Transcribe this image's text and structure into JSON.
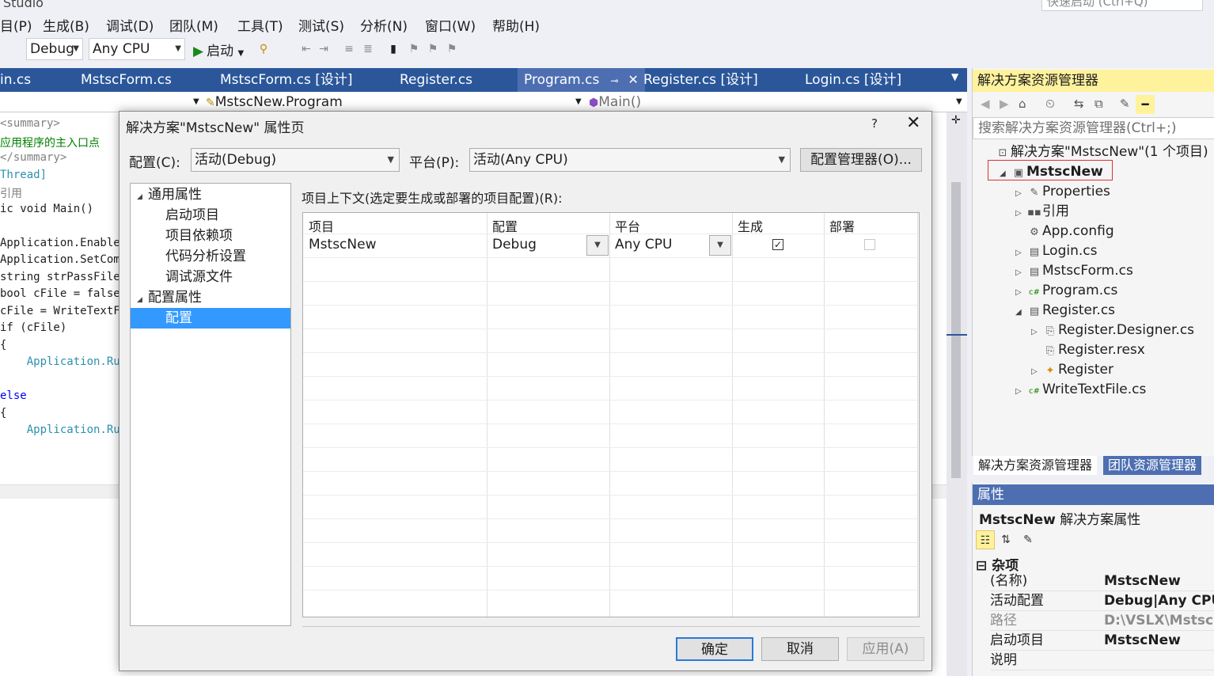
{
  "window": {
    "title_fragment": "Studio",
    "quick_launch": "快速启动 (Ctrl+Q)"
  },
  "menu": [
    "目(P)",
    "生成(B)",
    "调试(D)",
    "团队(M)",
    "工具(T)",
    "测试(S)",
    "分析(N)",
    "窗口(W)",
    "帮助(H)"
  ],
  "toolbar": {
    "config_combo": "Debug",
    "platform_combo": "Any CPU",
    "start_label": "启动"
  },
  "tabs": [
    {
      "label": "in.cs",
      "active": false
    },
    {
      "label": "MstscForm.cs",
      "active": false
    },
    {
      "label": "MstscForm.cs [设计]",
      "active": false
    },
    {
      "label": "Register.cs",
      "active": false
    },
    {
      "label": "Program.cs",
      "active": true
    },
    {
      "label": "Register.cs [设计]",
      "active": false
    },
    {
      "label": "Login.cs [设计]",
      "active": false
    }
  ],
  "navbar": {
    "class_combo": "MstscNew.Program",
    "member_combo": "Main()"
  },
  "code": [
    {
      "t": "<summary>",
      "c": "c-gray"
    },
    {
      "t": "应用程序的主入口点",
      "c": "c-green"
    },
    {
      "t": "</summary>",
      "c": "c-gray"
    },
    {
      "t": "Thread]",
      "c": "c-teal"
    },
    {
      "t": "引用",
      "c": "c-gray"
    },
    {
      "t": "ic void Main()",
      "c": "c-dark"
    },
    {
      "t": "",
      "c": "c-dark"
    },
    {
      "t": "Application.Enable",
      "c": "c-dark"
    },
    {
      "t": "Application.SetCom",
      "c": "c-dark"
    },
    {
      "t": "string strPassFile",
      "c": "c-dark"
    },
    {
      "t": "bool cFile = false",
      "c": "c-dark"
    },
    {
      "t": "cFile = WriteTextF",
      "c": "c-dark"
    },
    {
      "t": "if (cFile)",
      "c": "c-dark"
    },
    {
      "t": "{",
      "c": "c-dark"
    },
    {
      "t": "    Application.Ru",
      "c": "c-teal"
    },
    {
      "t": "",
      "c": "c-dark"
    },
    {
      "t": "else",
      "c": "c-blue"
    },
    {
      "t": "{",
      "c": "c-dark"
    },
    {
      "t": "    Application.Ru",
      "c": "c-teal"
    }
  ],
  "solution_explorer": {
    "title": "解决方案资源管理器",
    "search_placeholder": "搜索解决方案资源管理器(Ctrl+;)",
    "items": [
      {
        "label": "解决方案\"MstscNew\"(1 个项目)",
        "indent": 0,
        "exp": "",
        "icon": "solution-icon",
        "glyph": "⊡",
        "bold": false
      },
      {
        "label": "MstscNew",
        "indent": 1,
        "exp": "◢",
        "icon": "csharp-project-icon",
        "glyph": "▣",
        "bold": true
      },
      {
        "label": "Properties",
        "indent": 2,
        "exp": "▷",
        "icon": "wrench-icon",
        "glyph": "✎",
        "bold": false
      },
      {
        "label": "引用",
        "indent": 2,
        "exp": "▷",
        "icon": "references-icon",
        "glyph": "▪▪",
        "bold": false
      },
      {
        "label": "App.config",
        "indent": 2,
        "exp": "",
        "icon": "config-file-icon",
        "glyph": "⚙",
        "bold": false
      },
      {
        "label": "Login.cs",
        "indent": 2,
        "exp": "▷",
        "icon": "form-icon",
        "glyph": "▤",
        "bold": false
      },
      {
        "label": "MstscForm.cs",
        "indent": 2,
        "exp": "▷",
        "icon": "form-icon",
        "glyph": "▤",
        "bold": false
      },
      {
        "label": "Program.cs",
        "indent": 2,
        "exp": "▷",
        "icon": "csharp-file-icon",
        "glyph": "c#",
        "bold": false
      },
      {
        "label": "Register.cs",
        "indent": 2,
        "exp": "◢",
        "icon": "form-icon",
        "glyph": "▤",
        "bold": false
      },
      {
        "label": "Register.Designer.cs",
        "indent": 3,
        "exp": "▷",
        "icon": "designer-file-icon",
        "glyph": "⎘",
        "bold": false
      },
      {
        "label": "Register.resx",
        "indent": 3,
        "exp": "",
        "icon": "resx-file-icon",
        "glyph": "⎘",
        "bold": false
      },
      {
        "label": "Register",
        "indent": 3,
        "exp": "▷",
        "icon": "class-icon",
        "glyph": "✦",
        "bold": false
      },
      {
        "label": "WriteTextFile.cs",
        "indent": 2,
        "exp": "▷",
        "icon": "csharp-file-icon",
        "glyph": "c#",
        "bold": false
      }
    ],
    "tabs": [
      "解决方案资源管理器",
      "团队资源管理器"
    ]
  },
  "properties": {
    "title": "属性",
    "subject_name": "MstscNew",
    "subject_type": "解决方案属性",
    "category": "杂项",
    "rows": [
      {
        "key": "(名称)",
        "value": "MstscNew",
        "dim": false
      },
      {
        "key": "活动配置",
        "value": "Debug|Any CPU",
        "dim": false
      },
      {
        "key": "路径",
        "value": "D:\\VSLX\\MstscN",
        "dim": true
      },
      {
        "key": "启动项目",
        "value": "MstscNew",
        "dim": false
      },
      {
        "key": "说明",
        "value": "",
        "dim": false
      }
    ]
  },
  "dialog": {
    "title": "解决方案\"MstscNew\" 属性页",
    "help": "?",
    "config_label": "配置(C):",
    "config_value": "活动(Debug)",
    "platform_label": "平台(P):",
    "platform_value": "活动(Any CPU)",
    "config_manager_button": "配置管理器(O)...",
    "tree": [
      {
        "label": "通用属性",
        "level": 0,
        "exp": "◢",
        "selected": false
      },
      {
        "label": "启动项目",
        "level": 1,
        "exp": "",
        "selected": false
      },
      {
        "label": "项目依赖项",
        "level": 1,
        "exp": "",
        "selected": false
      },
      {
        "label": "代码分析设置",
        "level": 1,
        "exp": "",
        "selected": false
      },
      {
        "label": "调试源文件",
        "level": 1,
        "exp": "",
        "selected": false
      },
      {
        "label": "配置属性",
        "level": 0,
        "exp": "◢",
        "selected": false
      },
      {
        "label": "配置",
        "level": 1,
        "exp": "",
        "selected": true
      }
    ],
    "context_label": "项目上下文(选定要生成或部署的项目配置)(R):",
    "grid": {
      "headers": [
        "项目",
        "配置",
        "平台",
        "生成",
        "部署"
      ],
      "row": {
        "project": "MstscNew",
        "config": "Debug",
        "platform": "Any CPU",
        "build": true,
        "deploy": false
      }
    },
    "ok": "确定",
    "cancel": "取消",
    "apply": "应用(A)"
  }
}
